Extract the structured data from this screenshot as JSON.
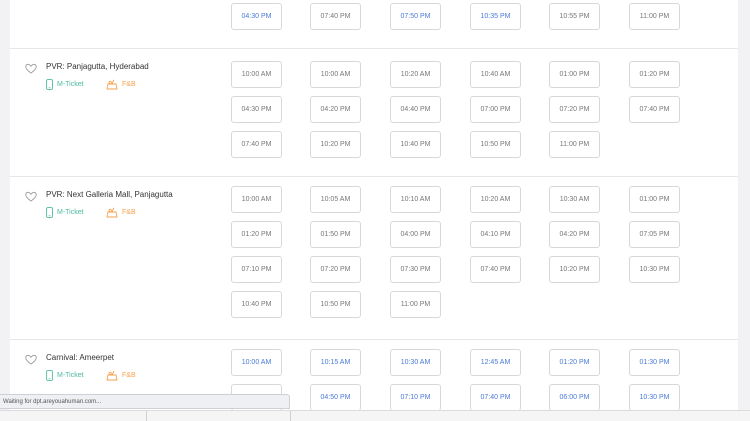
{
  "cinemas": [
    {
      "name": "",
      "mticket": "",
      "fnb": "",
      "show_venue": false,
      "times": [
        {
          "time": "04:30 PM",
          "available": true
        },
        {
          "time": "07:40 PM",
          "available": false
        },
        {
          "time": "07:50 PM",
          "available": true
        },
        {
          "time": "10:35 PM",
          "available": true
        },
        {
          "time": "10:55 PM",
          "available": false
        },
        {
          "time": "11:00 PM",
          "available": false
        }
      ]
    },
    {
      "name": "PVR: Panjagutta, Hyderabad",
      "mticket": "M-Ticket",
      "fnb": "F&B",
      "show_venue": true,
      "times": [
        {
          "time": "10:00 AM",
          "available": false
        },
        {
          "time": "10:00 AM",
          "available": false
        },
        {
          "time": "10:20 AM",
          "available": false
        },
        {
          "time": "10:40 AM",
          "available": false
        },
        {
          "time": "01:00 PM",
          "available": false
        },
        {
          "time": "01:20 PM",
          "available": false
        },
        {
          "time": "04:30 PM",
          "available": false
        },
        {
          "time": "04:20 PM",
          "available": false
        },
        {
          "time": "04:40 PM",
          "available": false
        },
        {
          "time": "07:00 PM",
          "available": false
        },
        {
          "time": "07:20 PM",
          "available": false
        },
        {
          "time": "07:40 PM",
          "available": false
        },
        {
          "time": "07:40 PM",
          "available": false
        },
        {
          "time": "10:20 PM",
          "available": false
        },
        {
          "time": "10:40 PM",
          "available": false
        },
        {
          "time": "10:50 PM",
          "available": false
        },
        {
          "time": "11:00 PM",
          "available": false
        }
      ]
    },
    {
      "name": "PVR: Next Galleria Mall, Panjagutta",
      "mticket": "M-Ticket",
      "fnb": "F&B",
      "show_venue": true,
      "times": [
        {
          "time": "10:00 AM",
          "available": false
        },
        {
          "time": "10:05 AM",
          "available": false
        },
        {
          "time": "10:10 AM",
          "available": false
        },
        {
          "time": "10:20 AM",
          "available": false
        },
        {
          "time": "10:30 AM",
          "available": false
        },
        {
          "time": "01:00 PM",
          "available": false
        },
        {
          "time": "01:20 PM",
          "available": false
        },
        {
          "time": "01:50 PM",
          "available": false
        },
        {
          "time": "04:00 PM",
          "available": false
        },
        {
          "time": "04:10 PM",
          "available": false
        },
        {
          "time": "04:20 PM",
          "available": false
        },
        {
          "time": "07:05 PM",
          "available": false
        },
        {
          "time": "07:10 PM",
          "available": false
        },
        {
          "time": "07:20 PM",
          "available": false
        },
        {
          "time": "07:30 PM",
          "available": false
        },
        {
          "time": "07:40 PM",
          "available": false
        },
        {
          "time": "10:20 PM",
          "available": false
        },
        {
          "time": "10:30 PM",
          "available": false
        },
        {
          "time": "10:40 PM",
          "available": false
        },
        {
          "time": "10:50 PM",
          "available": false
        },
        {
          "time": "11:00 PM",
          "available": false
        }
      ]
    },
    {
      "name": "Carnival: Ameerpet",
      "mticket": "M-Ticket",
      "fnb": "F&B",
      "show_venue": true,
      "times": [
        {
          "time": "10:00 AM",
          "available": true
        },
        {
          "time": "10:15 AM",
          "available": true
        },
        {
          "time": "10:30 AM",
          "available": true
        },
        {
          "time": "12:45 AM",
          "available": true
        },
        {
          "time": "01:20 PM",
          "available": true
        },
        {
          "time": "01:30 PM",
          "available": true
        },
        {
          "time": "",
          "available": true
        },
        {
          "time": "04:50 PM",
          "available": true
        },
        {
          "time": "07:10 PM",
          "available": true
        },
        {
          "time": "07:40 PM",
          "available": true
        },
        {
          "time": "06:00 PM",
          "available": true
        },
        {
          "time": "10:30 PM",
          "available": true
        }
      ]
    }
  ],
  "status_bar": {
    "text": "Waiting for dpt.areyouahuman.com..."
  },
  "colors": {
    "available": "#4a7ad6",
    "unavailable": "#777777",
    "mticket": "#4cb9a0",
    "fnb": "#f6a04d"
  },
  "icons": {
    "favorite": "heart-icon",
    "mticket": "mobile-ticket-icon",
    "fnb": "food-beverage-icon"
  }
}
